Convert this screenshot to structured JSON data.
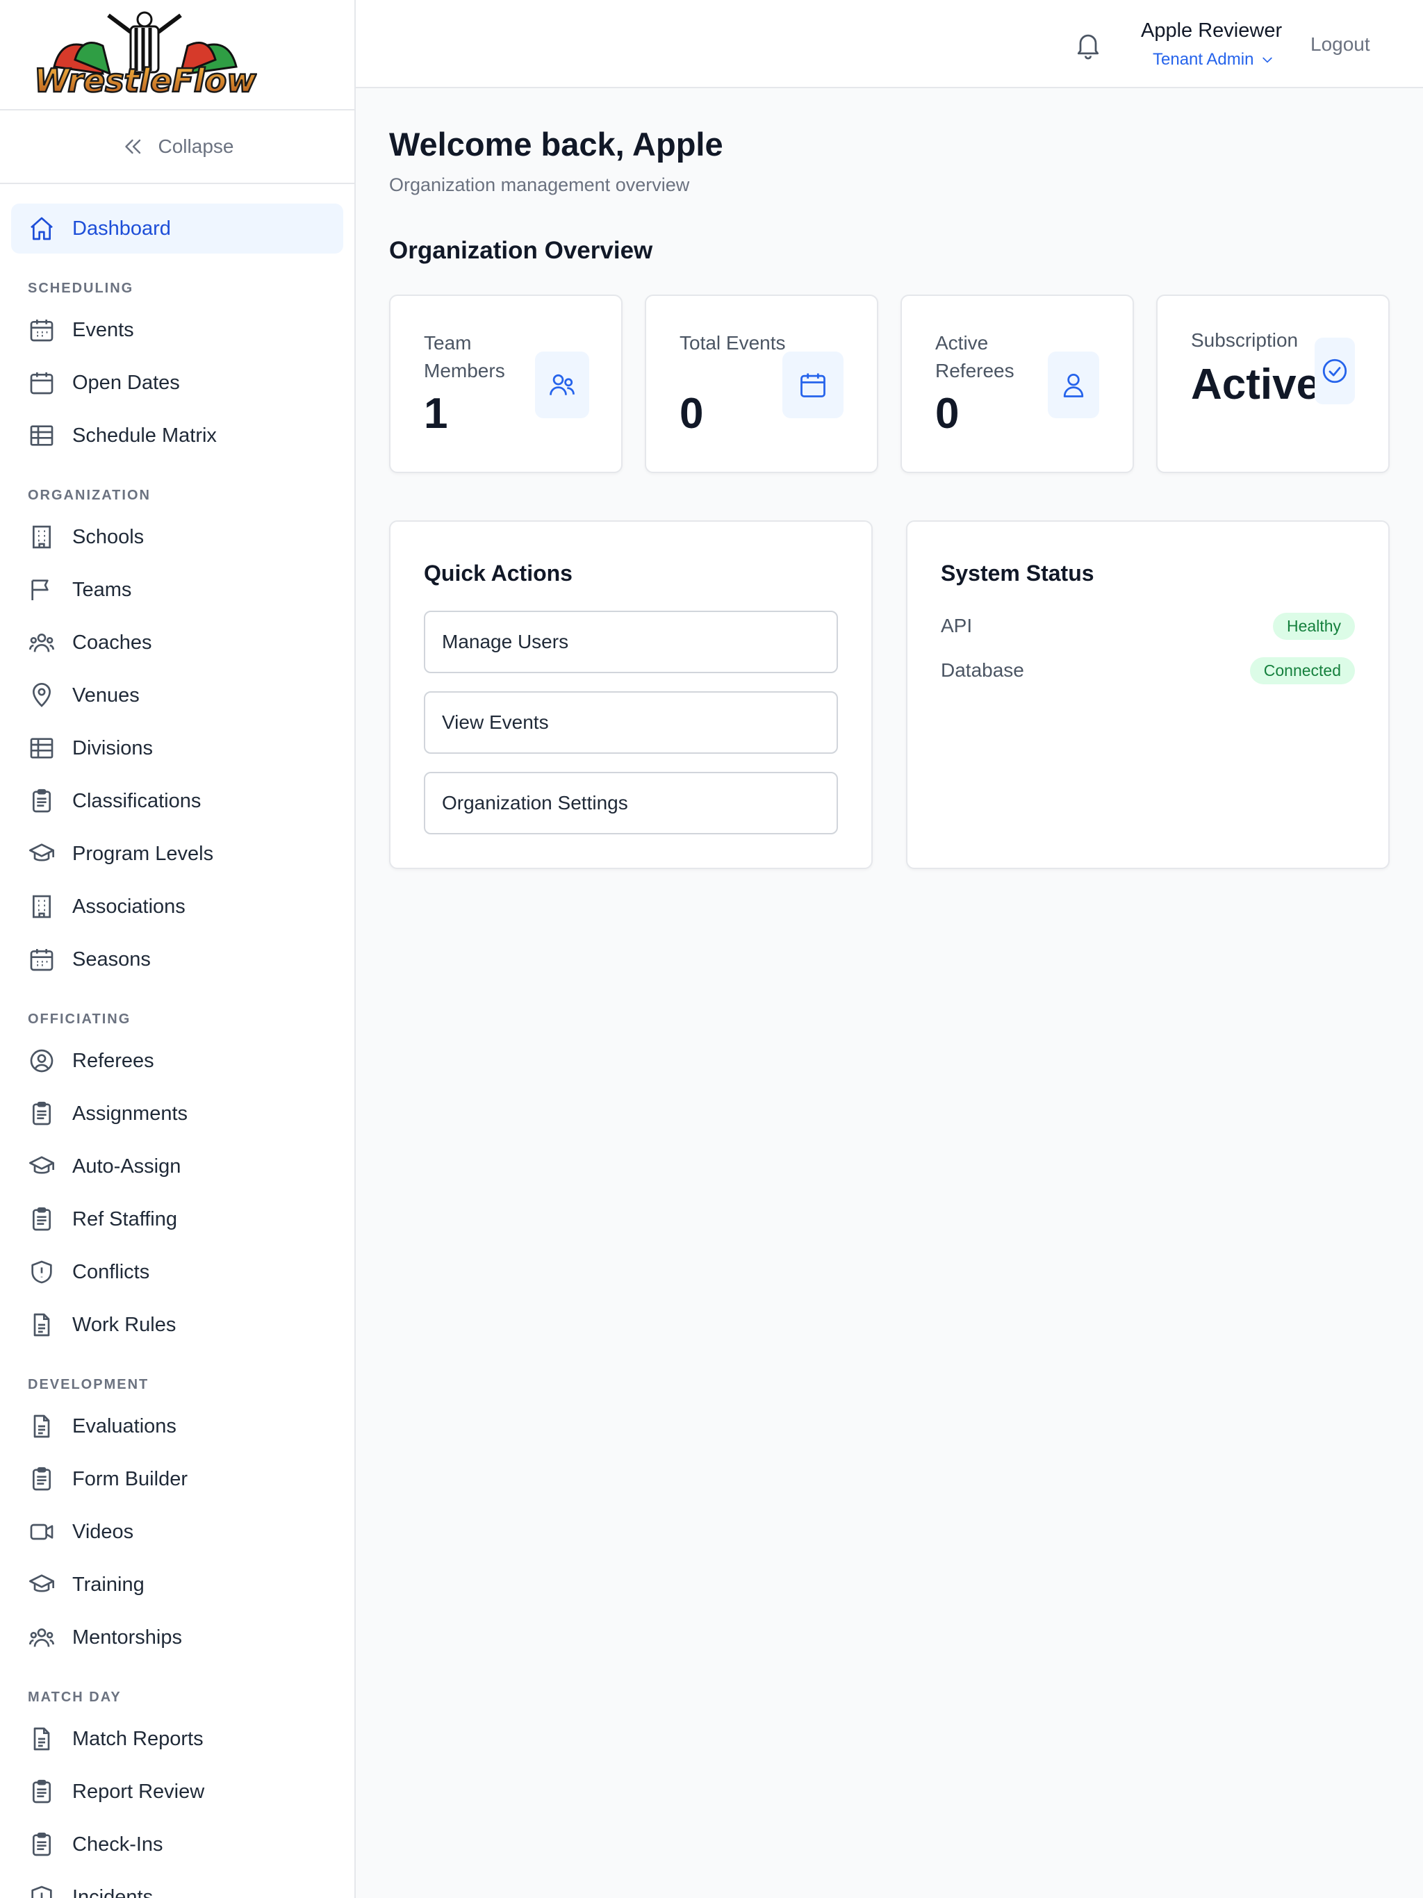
{
  "app": {
    "logo_text": "WrestleFlow",
    "collapse_label": "Collapse"
  },
  "sidebar": {
    "dashboard": "Dashboard",
    "sections": {
      "scheduling": "SCHEDULING",
      "organization": "ORGANIZATION",
      "officiating": "OFFICIATING",
      "development": "DEVELOPMENT",
      "match_day": "MATCH DAY"
    },
    "scheduling": [
      "Events",
      "Open Dates",
      "Schedule Matrix"
    ],
    "organization": [
      "Schools",
      "Teams",
      "Coaches",
      "Venues",
      "Divisions",
      "Classifications",
      "Program Levels",
      "Associations",
      "Seasons"
    ],
    "officiating": [
      "Referees",
      "Assignments",
      "Auto-Assign",
      "Ref Staffing",
      "Conflicts",
      "Work Rules"
    ],
    "development": [
      "Evaluations",
      "Form Builder",
      "Videos",
      "Training",
      "Mentorships"
    ],
    "match_day": [
      "Match Reports",
      "Report Review",
      "Check-Ins",
      "Incidents"
    ]
  },
  "header": {
    "user_name": "Apple Reviewer",
    "user_role": "Tenant Admin",
    "logout": "Logout"
  },
  "main": {
    "welcome": "Welcome back, Apple",
    "subtitle": "Organization management overview",
    "overview_title": "Organization Overview",
    "stats": [
      {
        "label": "Team Members",
        "value": "1",
        "icon": "users-icon"
      },
      {
        "label": "Total Events",
        "value": "0",
        "icon": "calendar-icon"
      },
      {
        "label": "Active Referees",
        "value": "0",
        "icon": "user-icon"
      }
    ],
    "subscription": {
      "label": "Subscription",
      "value": "Active",
      "icon": "check-circle-icon"
    },
    "quick_actions": {
      "title": "Quick Actions",
      "buttons": [
        "Manage Users",
        "View Events",
        "Organization Settings"
      ]
    },
    "system_status": {
      "title": "System Status",
      "rows": [
        {
          "label": "API",
          "status": "Healthy"
        },
        {
          "label": "Database",
          "status": "Connected"
        }
      ]
    }
  },
  "colors": {
    "accent": "#2563eb",
    "active_bg": "#eff6ff",
    "badge_bg": "#dcfce7",
    "badge_text": "#15803d"
  }
}
